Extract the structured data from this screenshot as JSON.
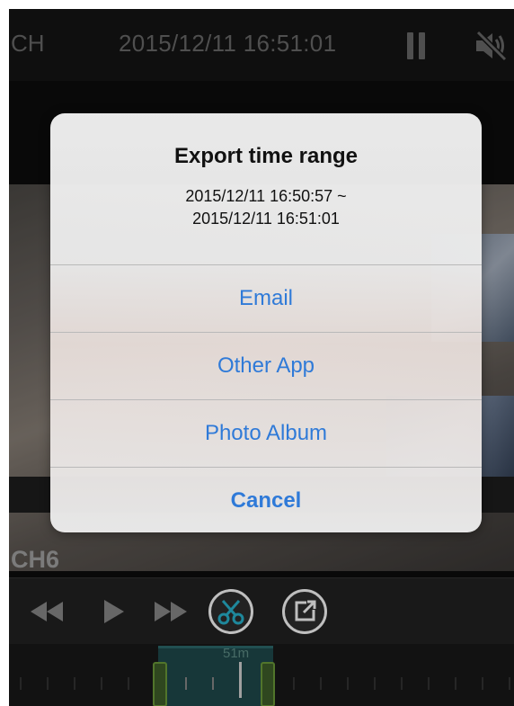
{
  "header": {
    "channel_button": "CH",
    "datetime": "2015/12/11 16:51:01",
    "pause_icon": "pause-icon",
    "mute_icon": "speaker-muted-icon"
  },
  "video": {
    "channel_label": "CH6"
  },
  "dialog": {
    "title": "Export time range",
    "message_line1": "2015/12/11 16:50:57 ~",
    "message_line2": "2015/12/11 16:51:01",
    "options": [
      "Email",
      "Other App",
      "Photo Album",
      "Cancel"
    ]
  },
  "controls": {
    "icons": [
      "rewind-icon",
      "play-icon",
      "fast-forward-icon",
      "scissors-icon",
      "export-icon"
    ]
  },
  "timeline": {
    "range_label": "51m"
  },
  "colors": {
    "accent_blue": "#2f7ad8",
    "cut_teal": "#29b6d0"
  }
}
